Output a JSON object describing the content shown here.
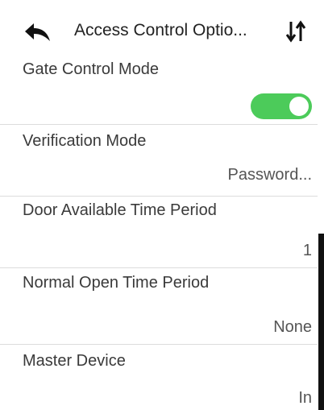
{
  "header": {
    "title": "Access Control Optio...",
    "back_icon": "back-arrow-icon",
    "sort_icon": "sort-arrows-icon"
  },
  "rows": [
    {
      "label": "Gate Control Mode",
      "value": "",
      "toggle_on": true
    },
    {
      "label": "Verification Mode",
      "value": "Password..."
    },
    {
      "label": "Door Available Time Period",
      "value": "1"
    },
    {
      "label": "Normal Open Time Period",
      "value": "None"
    },
    {
      "label": "Master Device",
      "value": "In"
    }
  ],
  "colors": {
    "toggle_on": "#4ccb5a",
    "scroll_thumb": "#111111",
    "divider": "#dcdcdc"
  },
  "scroll": {
    "position": 0.5
  }
}
